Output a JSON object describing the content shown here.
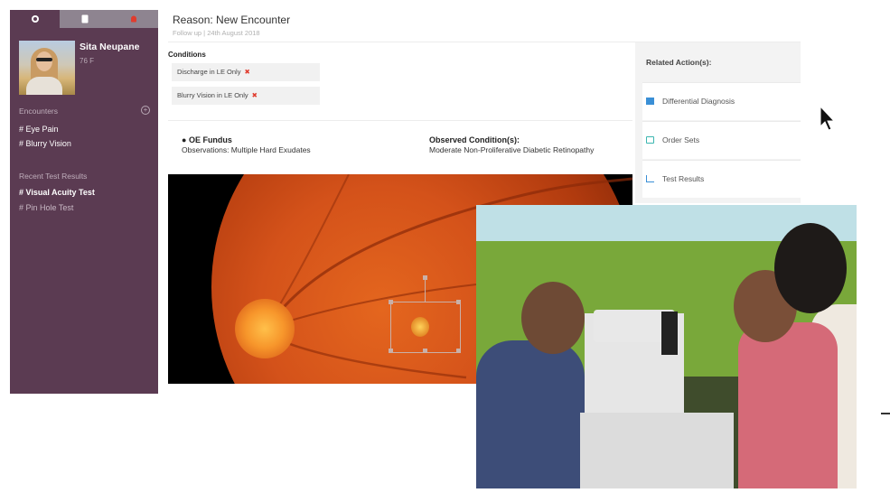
{
  "sidebar": {
    "tabs": [
      {
        "icon": "user-icon"
      },
      {
        "icon": "clipboard-icon"
      },
      {
        "icon": "bell-icon"
      }
    ],
    "patient_name": "Sita Neupane",
    "patient_meta": "76 F",
    "encounters_label": "Encounters",
    "encounters": [
      "# Eye Pain",
      "# Blurry Vision"
    ],
    "recent_label": "Recent Test Results",
    "recent": [
      "# Visual Acuity Test",
      "# Pin Hole Test"
    ]
  },
  "header": {
    "reason": "Reason: New Encounter",
    "followup": "Follow up | 24th August 2018"
  },
  "conditions": {
    "label": "Conditions",
    "items": [
      "Discharge in LE Only",
      "Blurry Vision in LE Only"
    ],
    "remove_glyph": "✖"
  },
  "finding": {
    "title": "OE Fundus",
    "observations": "Observations: Multiple Hard Exudates",
    "observed_label": "Observed Condition(s):",
    "observed_value": "Moderate Non-Proliferative Diabetic Retinopathy"
  },
  "related": {
    "title": "Related Action(s):",
    "items": [
      {
        "label": "Differential Diagnosis",
        "icon": "diagnosis-icon"
      },
      {
        "label": "Order Sets",
        "icon": "clipboard-icon"
      },
      {
        "label": "Test Results",
        "icon": "chart-icon"
      }
    ]
  },
  "colors": {
    "sidebar_bg": "#5b3b52",
    "accent_blue": "#3a8fd6",
    "remove_red": "#e03c2e"
  }
}
